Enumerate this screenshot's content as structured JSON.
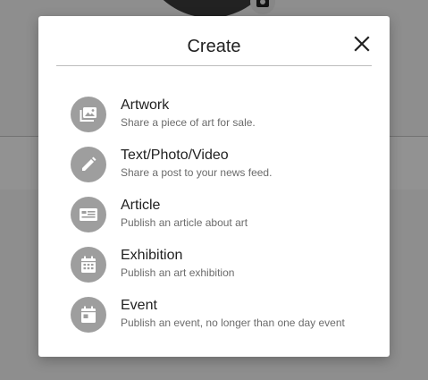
{
  "dialog": {
    "title": "Create",
    "close_icon": "close-icon"
  },
  "options": [
    {
      "icon": "image-icon",
      "title": "Artwork",
      "subtitle": "Share a piece of art for sale."
    },
    {
      "icon": "pencil-icon",
      "title": "Text/Photo/Video",
      "subtitle": "Share a post to your news feed."
    },
    {
      "icon": "article-icon",
      "title": "Article",
      "subtitle": "Publish an article about art"
    },
    {
      "icon": "calendar-grid-icon",
      "title": "Exhibition",
      "subtitle": "Publish an art exhibition"
    },
    {
      "icon": "calendar-event-icon",
      "title": "Event",
      "subtitle": "Publish an event, no longer than one day event"
    }
  ],
  "colors": {
    "icon_circle": "#9e9e9e",
    "overlay": "rgba(0,0,0,0.42)",
    "dialog_bg": "#ffffff"
  }
}
